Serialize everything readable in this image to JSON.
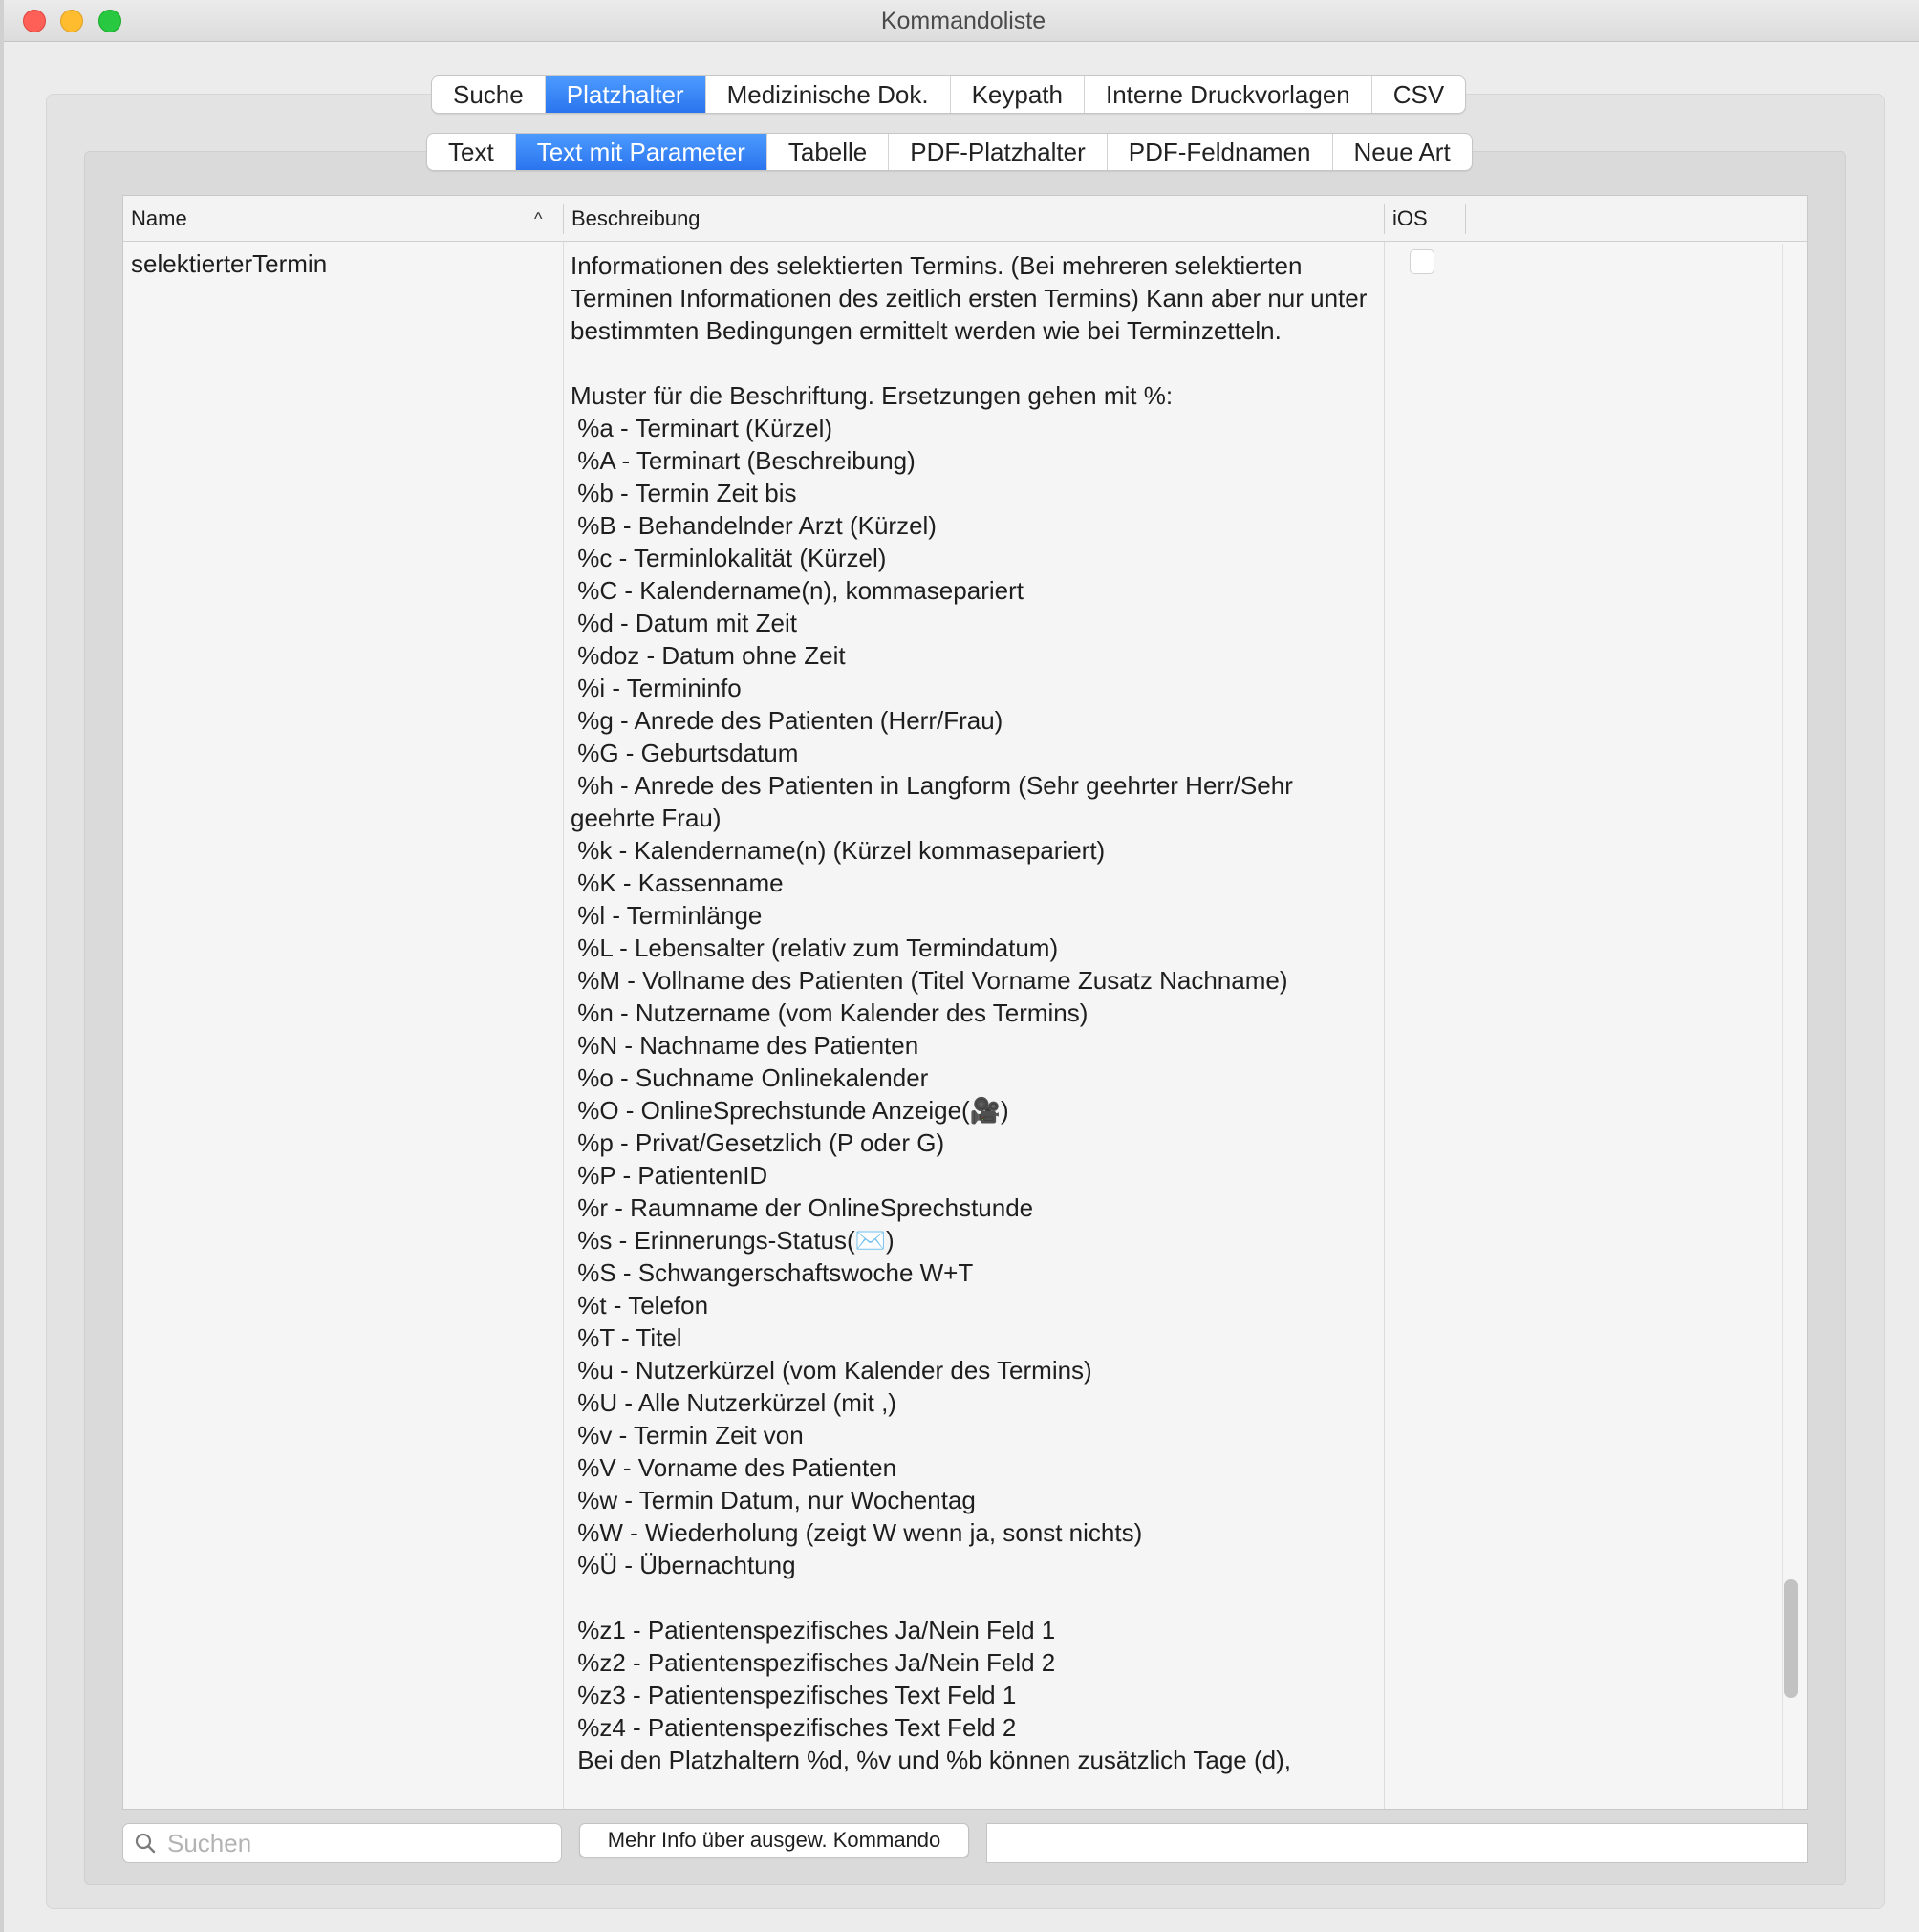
{
  "window": {
    "title": "Kommandoliste"
  },
  "tabs_top": [
    {
      "label": "Suche",
      "active": false
    },
    {
      "label": "Platzhalter",
      "active": true
    },
    {
      "label": "Medizinische Dok.",
      "active": false
    },
    {
      "label": "Keypath",
      "active": false
    },
    {
      "label": "Interne Druckvorlagen",
      "active": false
    },
    {
      "label": "CSV",
      "active": false
    }
  ],
  "tabs_sub": [
    {
      "label": "Text",
      "active": false
    },
    {
      "label": "Text mit Parameter",
      "active": true
    },
    {
      "label": "Tabelle",
      "active": false
    },
    {
      "label": "PDF-Platzhalter",
      "active": false
    },
    {
      "label": "PDF-Feldnamen",
      "active": false
    },
    {
      "label": "Neue Art",
      "active": false
    }
  ],
  "table": {
    "columns": [
      "Name",
      "Beschreibung",
      "iOS"
    ],
    "sort_indicator": "^",
    "rows": [
      {
        "name": "selektierterTermin",
        "ios_checked": false,
        "description": "Informationen des selektierten Termins. (Bei mehreren selektierten Terminen Informationen des zeitlich ersten Termins) Kann aber nur unter bestimmten Bedingungen ermittelt werden wie bei Terminzetteln.\n\nMuster für die Beschriftung. Ersetzungen gehen mit %:\n %a - Terminart (Kürzel)\n %A - Terminart (Beschreibung)\n %b - Termin Zeit bis\n %B - Behandelnder Arzt (Kürzel)\n %c - Terminlokalität (Kürzel)\n %C - Kalendername(n), kommasepariert\n %d - Datum mit Zeit\n %doz - Datum ohne Zeit\n %i - Termininfo\n %g - Anrede des Patienten (Herr/Frau)\n %G - Geburtsdatum\n %h - Anrede des Patienten in Langform (Sehr geehrter Herr/Sehr geehrte Frau)\n %k - Kalendername(n) (Kürzel kommasepariert)\n %K - Kassenname\n %l - Terminlänge\n %L - Lebensalter (relativ zum Termindatum)\n %M - Vollname des Patienten (Titel Vorname Zusatz Nachname)\n %n - Nutzername (vom Kalender des Termins)\n %N - Nachname des Patienten\n %o - Suchname Onlinekalender\n %O - OnlineSprechstunde Anzeige(🎥)\n %p - Privat/Gesetzlich (P oder G)\n %P - PatientenID\n %r - Raumname der OnlineSprechstunde\n %s - Erinnerungs-Status(✉️)\n %S - Schwangerschaftswoche W+T\n %t - Telefon\n %T - Titel\n %u - Nutzerkürzel (vom Kalender des Termins)\n %U - Alle Nutzerkürzel (mit ,)\n %v - Termin Zeit von\n %V - Vorname des Patienten\n %w - Termin Datum, nur Wochentag\n %W - Wiederholung (zeigt W wenn ja, sonst nichts)\n %Ü - Übernachtung\n\n %z1 - Patientenspezifisches Ja/Nein Feld 1\n %z2 - Patientenspezifisches Ja/Nein Feld 2\n %z3 - Patientenspezifisches Text Feld 1\n %z4 - Patientenspezifisches Text Feld 2\n Bei den Platzhaltern %d, %v und %b können zusätzlich Tage (d),"
      }
    ]
  },
  "footer": {
    "search_placeholder": "Suchen",
    "search_value": "",
    "more_info_label": "Mehr Info über ausgew. Kommando",
    "info_value": ""
  },
  "icons": {
    "search": "search-icon",
    "sort": "sort-ascending-icon"
  },
  "colors": {
    "accent": "#2f7cf6",
    "close": "#fe5f57",
    "minimize": "#febc2e",
    "maximize": "#28c840"
  }
}
